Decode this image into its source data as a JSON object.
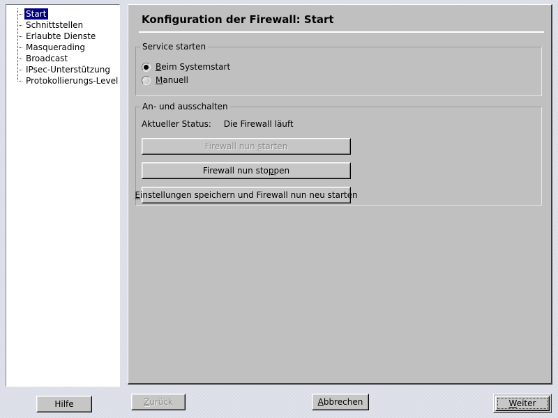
{
  "window": {
    "background_color": "#dfe2ea",
    "panel_color": "#c0c0c0",
    "selection_color": "#000080"
  },
  "tree": {
    "items": [
      {
        "label": "Start",
        "selected": true
      },
      {
        "label": "Schnittstellen",
        "selected": false
      },
      {
        "label": "Erlaubte Dienste",
        "selected": false
      },
      {
        "label": "Masquerading",
        "selected": false
      },
      {
        "label": "Broadcast",
        "selected": false
      },
      {
        "label": "IPsec-Unterstützung",
        "selected": false
      },
      {
        "label": "Protokollierungs-Level",
        "selected": false
      }
    ]
  },
  "content": {
    "title": "Konfiguration der Firewall: Start",
    "service_group": {
      "title": "Service starten",
      "options": [
        {
          "accel": "B",
          "rest": "eim Systemstart",
          "checked": true
        },
        {
          "accel": "M",
          "rest": "anuell",
          "checked": false
        }
      ]
    },
    "onoff_group": {
      "title": "An- und ausschalten",
      "status_label": "Aktueller Status:",
      "status_value": "Die Firewall läuft",
      "buttons": [
        {
          "pre": "Firewall nun ",
          "accel": "s",
          "post": "tarten",
          "disabled": true
        },
        {
          "pre": "Firewall nun sto",
          "accel": "p",
          "post": "pen",
          "disabled": false
        },
        {
          "pre": "",
          "accel": "E",
          "post": "instellungen speichern und Firewall nun neu starten",
          "disabled": false
        }
      ]
    }
  },
  "bottom_bar": {
    "help": {
      "label": "Hilfe",
      "disabled": false
    },
    "back": {
      "pre": "",
      "accel": "Z",
      "post": "urück",
      "disabled": true
    },
    "cancel": {
      "pre": "",
      "accel": "A",
      "post": "bbrechen",
      "disabled": false
    },
    "next": {
      "pre": "",
      "accel": "W",
      "post": "eiter",
      "disabled": false,
      "default": true
    }
  }
}
